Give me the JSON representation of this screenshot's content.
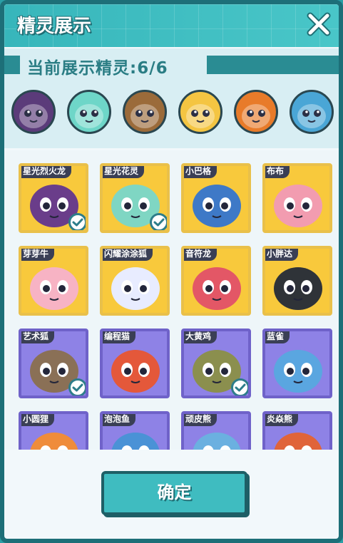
{
  "window": {
    "title": "精灵展示",
    "close_icon": "close-icon"
  },
  "display": {
    "label": "当前展示精灵:6/6"
  },
  "shown_sprites": [
    {
      "icon": "purple-dragon-avatar",
      "color": "#5b3b7a"
    },
    {
      "icon": "teal-flower-avatar",
      "color": "#6ed6c8"
    },
    {
      "icon": "brown-monkey-avatar",
      "color": "#9b6b3a"
    },
    {
      "icon": "yellow-duck-pilot-avatar",
      "color": "#f4c542"
    },
    {
      "icon": "orange-lion-avatar",
      "color": "#e87b2a"
    },
    {
      "icon": "blue-crystal-avatar",
      "color": "#4aa6d6"
    }
  ],
  "grid": [
    {
      "name": "星光烈火龙",
      "selected": true,
      "bg": "gold"
    },
    {
      "name": "星光花灵",
      "selected": true,
      "bg": "gold"
    },
    {
      "name": "小巴格",
      "selected": false,
      "bg": "gold"
    },
    {
      "name": "布布",
      "selected": false,
      "bg": "gold"
    },
    {
      "name": "芽芽牛",
      "selected": false,
      "bg": "gold"
    },
    {
      "name": "闪耀涂涂狐",
      "selected": false,
      "bg": "gold"
    },
    {
      "name": "音符龙",
      "selected": false,
      "bg": "gold"
    },
    {
      "name": "小胖达",
      "selected": false,
      "bg": "gold"
    },
    {
      "name": "艺术狐",
      "selected": true,
      "bg": "purple"
    },
    {
      "name": "编程猫",
      "selected": false,
      "bg": "purple"
    },
    {
      "name": "大黄鸡",
      "selected": true,
      "bg": "purple"
    },
    {
      "name": "蓝雀",
      "selected": false,
      "bg": "purple"
    },
    {
      "name": "小圆狸",
      "selected": false,
      "bg": "purple"
    },
    {
      "name": "泡泡鱼",
      "selected": false,
      "bg": "purple"
    },
    {
      "name": "顽皮熊",
      "selected": false,
      "bg": "purple"
    },
    {
      "name": "炎焱熊",
      "selected": false,
      "bg": "purple"
    }
  ],
  "confirm_button": {
    "label": "确定"
  }
}
